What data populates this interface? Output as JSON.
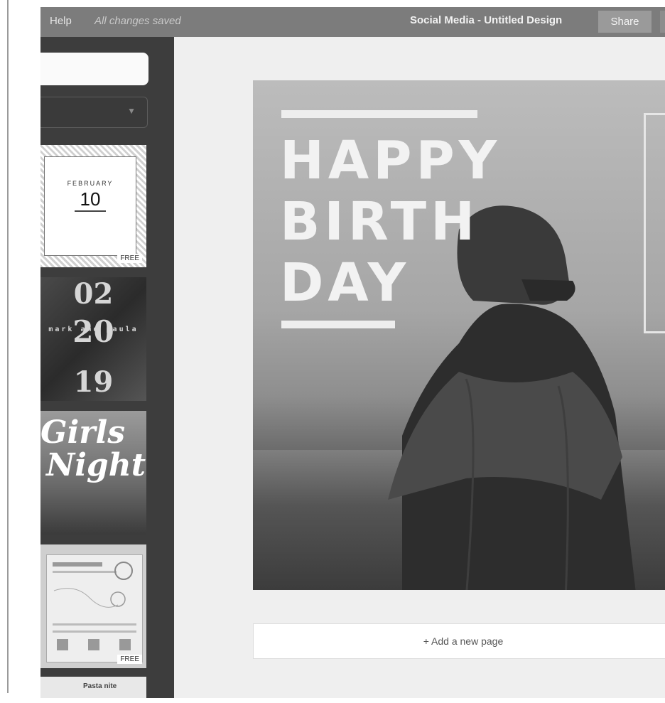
{
  "topbar": {
    "help_label": "Help",
    "save_status": "All changes saved",
    "document_title": "Social Media - Untitled Design",
    "share_label": "Share"
  },
  "sidebar": {
    "search": {
      "placeholder": ""
    },
    "templates": [
      {
        "month": "FEBRUARY",
        "day": "10",
        "badge": "FREE"
      },
      {
        "line1": "02",
        "names": "mark and paula",
        "line2": "20",
        "line3": "19"
      },
      {
        "line1": "Girls",
        "line2": "Night"
      },
      {
        "badge": "FREE"
      },
      {
        "label": "Pasta nite"
      }
    ]
  },
  "design": {
    "headline": [
      "HAPPY",
      "BIRTH",
      "DAY"
    ]
  },
  "canvas": {
    "add_page_label": "+ Add a new page"
  },
  "colors": {
    "topbar": "#7c7c7c",
    "sidebar": "#3d3d3d",
    "canvas_bg": "#efefef"
  }
}
